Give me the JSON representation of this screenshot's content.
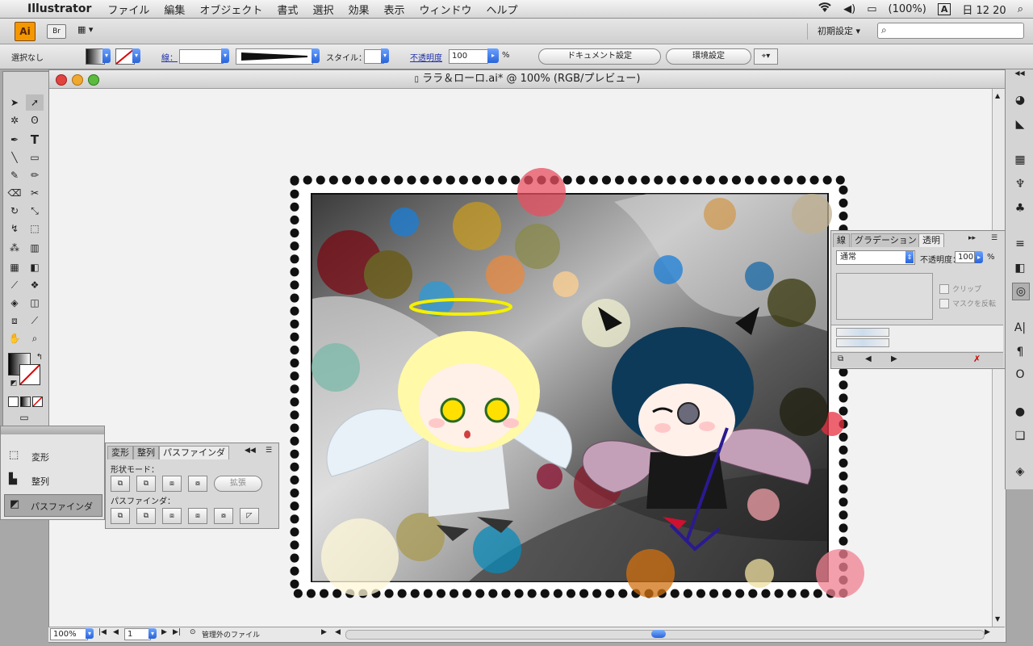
{
  "menubar": {
    "apple": "",
    "app_name": "Illustrator",
    "items": [
      "ファイル",
      "編集",
      "オブジェクト",
      "書式",
      "選択",
      "効果",
      "表示",
      "ウィンドウ",
      "ヘルプ"
    ],
    "battery": "(100%)",
    "input_method": "A",
    "clock": "日 12 20"
  },
  "appbar": {
    "logo": "Ai",
    "bridge": "Br",
    "workspace": "初期設定 ▾"
  },
  "control": {
    "selection": "選択なし",
    "stroke_label": "線：",
    "style_label": "スタイル：",
    "opacity_label": "不透明度",
    "opacity_value": "100",
    "percent": "%",
    "doc_settings": "ドキュメント設定",
    "prefs": "環境設定"
  },
  "document": {
    "title": "ララ＆ローロ.ai* @ 100% (RGB/プレビュー)",
    "zoom": "100%",
    "page": "1",
    "status": "管理外のファイル"
  },
  "transparency_panel": {
    "tabs": [
      "線",
      "グラデーション",
      "透明"
    ],
    "blend_mode": "通常",
    "opacity_label": "不透明度：",
    "opacity_value": "100",
    "percent": "%",
    "clip": "クリップ",
    "invert_mask": "マスクを反転"
  },
  "left_panel": {
    "items": [
      "変形",
      "整列",
      "パスファインダ"
    ]
  },
  "pathfinder_panel": {
    "tabs": [
      "変形",
      "整列",
      "パスファインダ"
    ],
    "shape_modes": "形状モード：",
    "expand": "拡張",
    "pathfinders": "パスファインダ："
  },
  "colors": {
    "ai_orange": "#f39800",
    "select_blue": "#2a63d8",
    "canvas_bg": "#f2f2f2"
  }
}
